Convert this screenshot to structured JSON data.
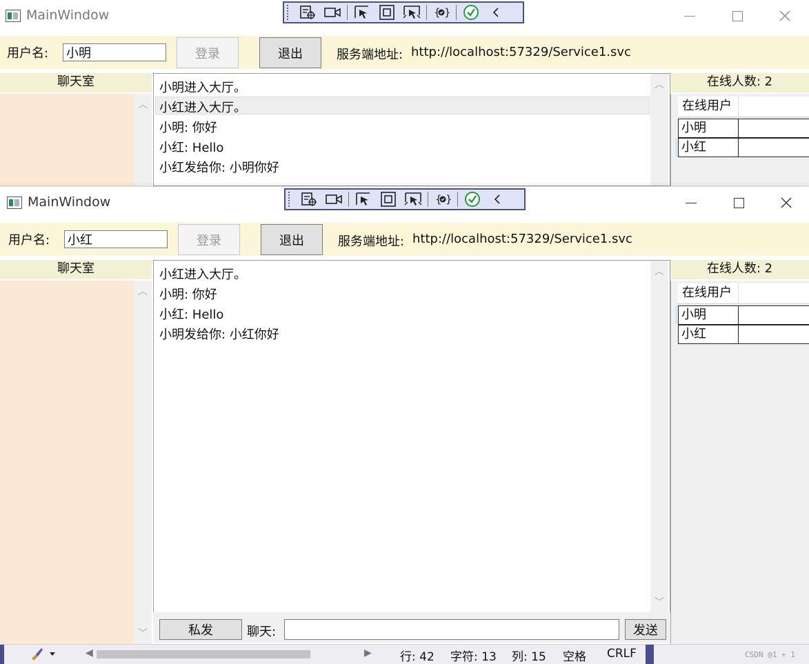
{
  "windows": [
    {
      "title": "MainWindow",
      "username_label": "用户名:",
      "username_value": "小明",
      "login_label": "登录",
      "logout_label": "退出",
      "server_label": "服务端地址:",
      "server_url": "http://localhost:57329/Service1.svc",
      "rooms_header": "聊天室",
      "messages": [
        "小明进入大厅。",
        "小红进入大厅。",
        "小明: 你好",
        "小红: Hello",
        "小红发给你:  小明你好"
      ],
      "online_count_label": "在线人数:",
      "online_count": "2",
      "online_column": "在线用户",
      "online_users": [
        "小明",
        "小红"
      ]
    },
    {
      "title": "MainWindow",
      "username_label": "用户名:",
      "username_value": "小红",
      "login_label": "登录",
      "logout_label": "退出",
      "server_label": "服务端地址:",
      "server_url": "http://localhost:57329/Service1.svc",
      "rooms_header": "聊天室",
      "messages": [
        "小红进入大厅。",
        "小明: 你好",
        "小红: Hello",
        "小明发给你:  小红你好"
      ],
      "online_count_label": "在线人数:",
      "online_count": "2",
      "online_column": "在线用户",
      "online_users": [
        "小明",
        "小红"
      ],
      "private_send_label": "私发",
      "chat_label": "聊天:",
      "chat_input_value": "",
      "send_label": "发送"
    }
  ],
  "statusbar": {
    "line": "行: 42",
    "char": "字符: 13",
    "col": "列: 15",
    "indent": "空格",
    "eol": "CRLF",
    "watermark": "CSDN @1 + 1"
  },
  "colors": {
    "toolbar_border": "#4a4f8c",
    "toolbar_bg": "#dfe3f6",
    "login_bar_bg": "#fcf6d8",
    "rooms_bg": "#fbe9d6",
    "header_bg": "#f3f1d4",
    "check_green": "#1e9e3a"
  },
  "icons": [
    "application-icon",
    "select-element-icon",
    "record-video-icon",
    "pointer-select-icon",
    "display-layout-icon",
    "track-element-icon",
    "binding-failures-icon",
    "hot-reload-ok-icon",
    "collapse-chevron-icon",
    "brush-icon"
  ]
}
